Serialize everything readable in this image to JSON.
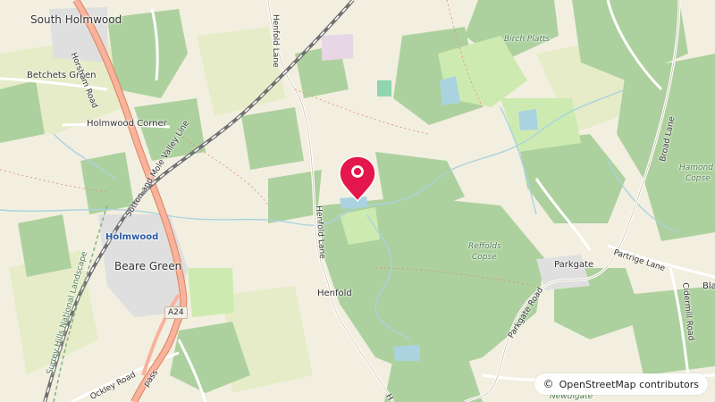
{
  "map": {
    "provider": "OpenStreetMap",
    "attribution": {
      "symbol": "©",
      "text": "OpenStreetMap contributors"
    },
    "marker": {
      "icon": "map-pin-icon",
      "color": "#e3174b"
    },
    "places": {
      "south_holmwood": "South Holmwood",
      "betchets_green": "Betchets Green",
      "holmwood_corner": "Holmwood Corner",
      "holmwood": "Holmwood",
      "beare_green": "Beare Green",
      "henfold": "Henfold",
      "parkgate": "Parkgate",
      "newdigate": "Newdigate",
      "bla": "Bla"
    },
    "woods": {
      "birch_platts": "Birch Platts",
      "reffolds_copse_1": "Reffolds",
      "reffolds_copse_2": "Copse",
      "hamond_copse_1": "Hamond",
      "hamond_copse_2": "Copse"
    },
    "roads": {
      "horsham_road": "Horsham Road",
      "henfold_lane_north": "Henfold Lane",
      "henfold_lane_mid": "Henfold Lane",
      "henfold_lane_south": "H",
      "sutton_mole_valley_line": "Sutton and Mole Valley Line",
      "broad_lane": "Broad Lane",
      "partridge_lane": "Partrige Lane",
      "cidermill_road": "Cidermill Road",
      "parkgate_road": "Parkgate Road",
      "ockley_road": "Ockley Road",
      "pass": "pass",
      "a24": "A24",
      "surrey_hills": "Surrey Hills National Landscape"
    },
    "colors": {
      "land": "#f2efe0",
      "forest": "#add19e",
      "meadow": "#cdebb0",
      "water": "#aad3df",
      "trunk_road": "#f9b29c",
      "railway": "#707070",
      "residential": "#e0dfdf",
      "marker": "#e3174b"
    }
  }
}
